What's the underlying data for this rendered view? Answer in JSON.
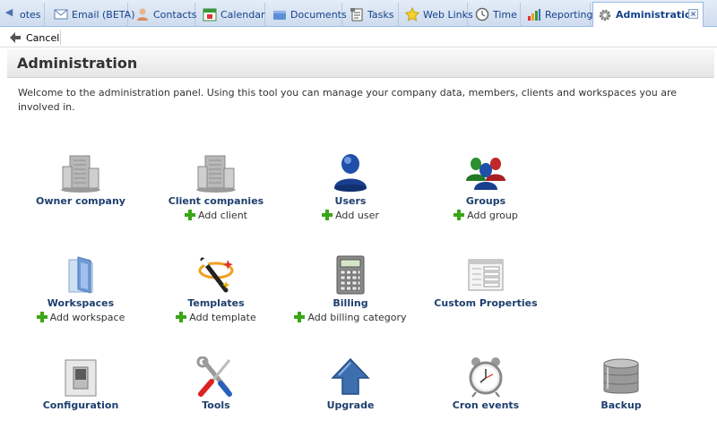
{
  "tabs": [
    {
      "label": "otes",
      "icon": "notes-icon"
    },
    {
      "label": "Email (BETA)",
      "icon": "email-icon"
    },
    {
      "label": "Contacts",
      "icon": "contacts-icon"
    },
    {
      "label": "Calendar",
      "icon": "calendar-icon"
    },
    {
      "label": "Documents",
      "icon": "documents-icon"
    },
    {
      "label": "Tasks",
      "icon": "tasks-icon"
    },
    {
      "label": "Web Links",
      "icon": "web-links-icon"
    },
    {
      "label": "Time",
      "icon": "time-icon"
    },
    {
      "label": "Reporting",
      "icon": "reporting-icon"
    },
    {
      "label": "Administration",
      "icon": "gear-icon",
      "active": true
    }
  ],
  "toolbar": {
    "cancel_label": "Cancel"
  },
  "page": {
    "title": "Administration",
    "intro": "Welcome to the administration panel. Using this tool you can manage your company data, members, clients and workspaces you are involved in."
  },
  "items": [
    {
      "label": "Owner company",
      "icon": "building-icon"
    },
    {
      "label": "Client companies",
      "icon": "building-icon",
      "add": "Add client"
    },
    {
      "label": "Users",
      "icon": "user-icon",
      "add": "Add user"
    },
    {
      "label": "Groups",
      "icon": "group-icon",
      "add": "Add group"
    },
    {
      "label": "Workspaces",
      "icon": "folder-icon",
      "add": "Add workspace"
    },
    {
      "label": "Templates",
      "icon": "magic-wand-icon",
      "add": "Add template"
    },
    {
      "label": "Billing",
      "icon": "calculator-icon",
      "add": "Add billing category"
    },
    {
      "label": "Custom Properties",
      "icon": "form-icon"
    },
    {
      "label": "Configuration",
      "icon": "switch-icon"
    },
    {
      "label": "Tools",
      "icon": "tools-icon"
    },
    {
      "label": "Upgrade",
      "icon": "upgrade-arrow-icon"
    },
    {
      "label": "Cron events",
      "icon": "alarm-clock-icon"
    },
    {
      "label": "Backup",
      "icon": "database-icon"
    }
  ],
  "colors": {
    "tab_text": "#15428b",
    "link_text": "#1d3f6e",
    "plus_green": "#3aa617"
  }
}
